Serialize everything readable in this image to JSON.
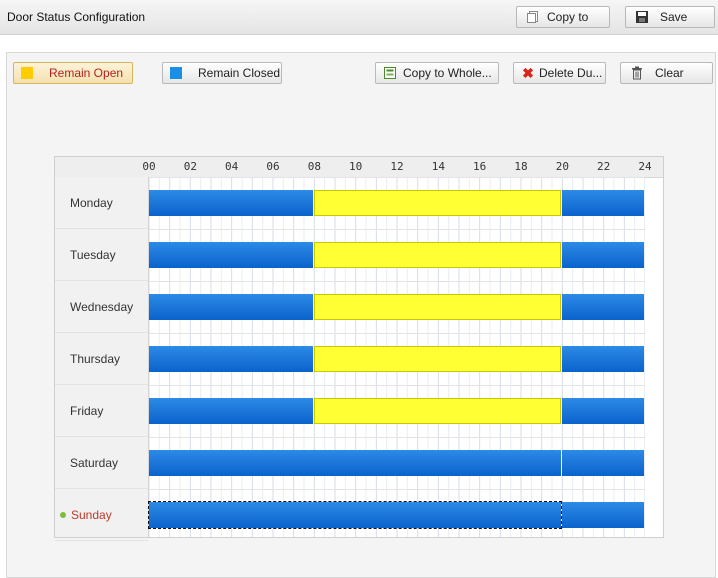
{
  "header": {
    "title": "Door Status Configuration",
    "copy_to_label": "Copy to",
    "save_label": "Save"
  },
  "toolbar": {
    "remain_open_label": "Remain Open",
    "remain_closed_label": "Remain Closed",
    "copy_to_whole_label": "Copy to Whole...",
    "delete_label": "Delete Du...",
    "clear_label": "Clear"
  },
  "colors": {
    "remain_open": "#ffff33",
    "remain_closed": "#0a70d8"
  },
  "schedule": {
    "hour_ticks": [
      "00",
      "02",
      "04",
      "06",
      "08",
      "10",
      "12",
      "14",
      "16",
      "18",
      "20",
      "22",
      "24"
    ],
    "selected_day": "Sunday",
    "days": [
      {
        "name": "Monday",
        "segments": [
          {
            "status": "closed",
            "start": 0,
            "end": 8
          },
          {
            "status": "open",
            "start": 8,
            "end": 20
          },
          {
            "status": "closed",
            "start": 20,
            "end": 24
          }
        ]
      },
      {
        "name": "Tuesday",
        "segments": [
          {
            "status": "closed",
            "start": 0,
            "end": 8
          },
          {
            "status": "open",
            "start": 8,
            "end": 20
          },
          {
            "status": "closed",
            "start": 20,
            "end": 24
          }
        ]
      },
      {
        "name": "Wednesday",
        "segments": [
          {
            "status": "closed",
            "start": 0,
            "end": 8
          },
          {
            "status": "open",
            "start": 8,
            "end": 20
          },
          {
            "status": "closed",
            "start": 20,
            "end": 24
          }
        ]
      },
      {
        "name": "Thursday",
        "segments": [
          {
            "status": "closed",
            "start": 0,
            "end": 8
          },
          {
            "status": "open",
            "start": 8,
            "end": 20
          },
          {
            "status": "closed",
            "start": 20,
            "end": 24
          }
        ]
      },
      {
        "name": "Friday",
        "segments": [
          {
            "status": "closed",
            "start": 0,
            "end": 8
          },
          {
            "status": "open",
            "start": 8,
            "end": 20
          },
          {
            "status": "closed",
            "start": 20,
            "end": 24
          }
        ]
      },
      {
        "name": "Saturday",
        "segments": [
          {
            "status": "closed",
            "start": 0,
            "end": 20
          },
          {
            "status": "closed",
            "start": 20,
            "end": 24
          }
        ]
      },
      {
        "name": "Sunday",
        "segments": [
          {
            "status": "closed",
            "start": 0,
            "end": 20,
            "selected": true
          },
          {
            "status": "closed",
            "start": 20,
            "end": 24
          }
        ]
      }
    ]
  }
}
